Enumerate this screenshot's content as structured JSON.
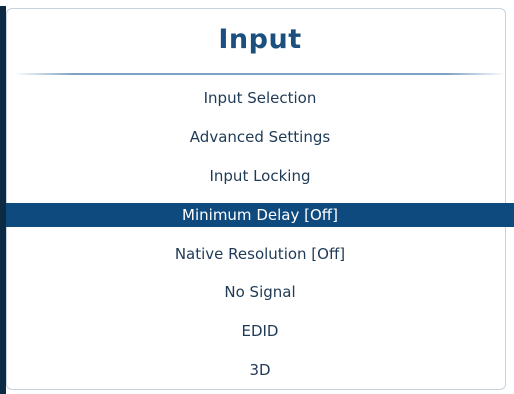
{
  "menu": {
    "title": "Input",
    "selected_index": 3,
    "items": [
      {
        "label": "Input Selection"
      },
      {
        "label": "Advanced Settings"
      },
      {
        "label": "Input Locking"
      },
      {
        "label": "Minimum Delay [Off]"
      },
      {
        "label": "Native Resolution [Off]"
      },
      {
        "label": "No Signal"
      },
      {
        "label": "EDID"
      },
      {
        "label": "3D"
      }
    ]
  },
  "colors": {
    "title": "#1b4f7e",
    "item_text": "#1f3a56",
    "highlight": "#0f4a7e",
    "highlight_text": "#ffffff"
  }
}
